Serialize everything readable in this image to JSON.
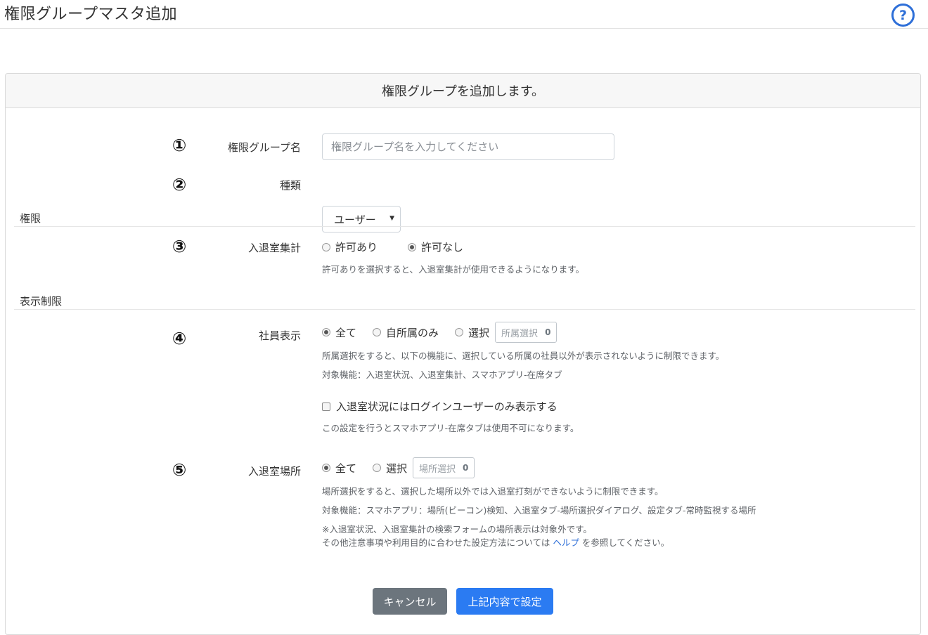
{
  "page": {
    "title": "権限グループマスタ追加",
    "help_icon": "question-circle-icon"
  },
  "card": {
    "header": "権限グループを追加します。"
  },
  "fields": {
    "group_name": {
      "number": "①",
      "label": "権限グループ名",
      "placeholder": "権限グループ名を入力してください",
      "value": ""
    },
    "type": {
      "number": "②",
      "label": "種類",
      "selected": "ユーザー"
    }
  },
  "sections": {
    "permission": {
      "title": "権限",
      "attendance_report": {
        "number": "③",
        "label": "入退室集計",
        "options": [
          "許可あり",
          "許可なし"
        ],
        "selected": "許可なし",
        "help": "許可ありを選択すると、入退室集計が使用できるようになります。"
      }
    },
    "display_restriction": {
      "title": "表示制限",
      "employee_display": {
        "number": "④",
        "label": "社員表示",
        "options": [
          "全て",
          "自所属のみ",
          "選択"
        ],
        "selected": "全て",
        "select_button": "所属選択",
        "select_count": "0",
        "help1": "所属選択をすると、以下の機能に、選択している所属の社員以外が表示されないように制限できます。",
        "help2": "対象機能：入退室状況、入退室集計、スマホアプリ-在席タブ",
        "checkbox_label": "入退室状況にはログインユーザーのみ表示する",
        "checkbox_checked": false,
        "checkbox_help": "この設定を行うとスマホアプリ-在席タブは使用不可になります。"
      },
      "location": {
        "number": "⑤",
        "label": "入退室場所",
        "options": [
          "全て",
          "選択"
        ],
        "selected": "全て",
        "select_button": "場所選択",
        "select_count": "0",
        "help1": "場所選択をすると、選択した場所以外では入退室打刻ができないように制限できます。",
        "help2": "対象機能：スマホアプリ：場所(ビーコン)検知、入退室タブ-場所選択ダイアログ、設定タブ-常時監視する場所",
        "help3": "※入退室状況、入退室集計の検索フォームの場所表示は対象外です。",
        "help4_prefix": "その他注意事項や利用目的に合わせた設定方法については",
        "help4_link": "ヘルプ",
        "help4_suffix": "を参照してください。"
      }
    }
  },
  "buttons": {
    "cancel": "キャンセル",
    "submit": "上記内容で設定"
  }
}
